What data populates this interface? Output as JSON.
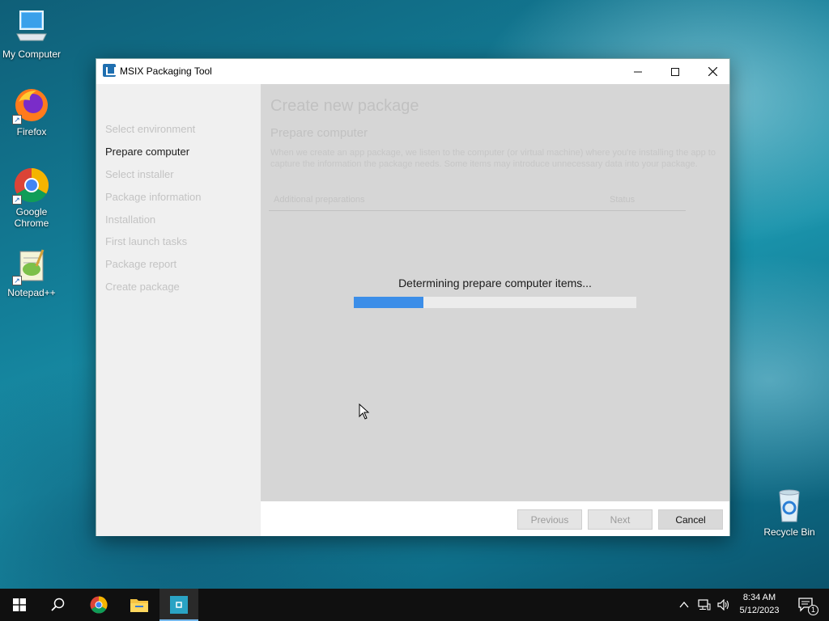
{
  "desktop": {
    "icons": [
      {
        "label": "My Computer",
        "icon": "computer-icon"
      },
      {
        "label": "Firefox",
        "icon": "firefox-icon"
      },
      {
        "label": "Google Chrome",
        "icon": "chrome-icon"
      },
      {
        "label": "Notepad++",
        "icon": "notepadpp-icon"
      },
      {
        "label": "Recycle Bin",
        "icon": "recycle-bin-icon"
      }
    ]
  },
  "window": {
    "title": "MSIX Packaging Tool",
    "controls": {
      "minimize": "—",
      "maximize": "☐",
      "close": "✕"
    }
  },
  "sidebar": {
    "items": [
      {
        "label": "Select environment",
        "state": "disabled"
      },
      {
        "label": "Prepare computer",
        "state": "active"
      },
      {
        "label": "Select installer",
        "state": "disabled"
      },
      {
        "label": "Package information",
        "state": "disabled"
      },
      {
        "label": "Installation",
        "state": "disabled"
      },
      {
        "label": "First launch tasks",
        "state": "disabled"
      },
      {
        "label": "Package report",
        "state": "disabled"
      },
      {
        "label": "Create package",
        "state": "disabled"
      }
    ]
  },
  "content": {
    "title": "Create new package",
    "subtitle": "Prepare computer",
    "description": "When we create an app package, we listen to the computer (or virtual machine) where you're installing the app to capture the information the package needs. Some items may introduce unnecessary data into your package.",
    "table": {
      "col1": "Additional preparations",
      "col2": "Status"
    },
    "progress": {
      "text": "Determining prepare computer items...",
      "fraction": 0.245
    }
  },
  "footer": {
    "previous": "Previous",
    "next": "Next",
    "cancel": "Cancel"
  },
  "taskbar": {
    "apps": [
      "start-icon",
      "search-icon",
      "chrome-icon",
      "file-explorer-icon",
      "msix-packaging-tool-icon"
    ],
    "clock": {
      "time": "8:34 AM",
      "date": "5/12/2023"
    },
    "notification_count": "1"
  },
  "colors": {
    "accent": "#3c8ee8",
    "taskbar": "#101010"
  }
}
